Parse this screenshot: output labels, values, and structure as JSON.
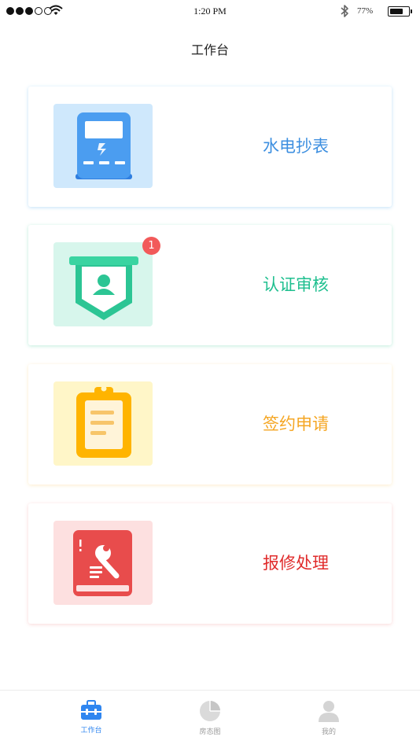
{
  "status_bar": {
    "time": "1:20 PM",
    "battery_percent": "77%",
    "signal_bars_filled": 3,
    "signal_bars_total": 5
  },
  "header": {
    "title": "工作台"
  },
  "cards": [
    {
      "label": "水电抄表",
      "icon": "meter-reading-icon",
      "color": "#3d8fe0",
      "tile_bg": "#cfe8fc"
    },
    {
      "label": "认证审核",
      "icon": "certification-review-icon",
      "color": "#1fbf8f",
      "tile_bg": "#d7f6ec",
      "badge": "1"
    },
    {
      "label": "签约申请",
      "icon": "contract-application-icon",
      "color": "#f5a623",
      "tile_bg": "#fff6c8"
    },
    {
      "label": "报修处理",
      "icon": "repair-handling-icon",
      "color": "#e02b2b",
      "tile_bg": "#fde0e0"
    }
  ],
  "tabbar": {
    "items": [
      {
        "label": "工作台",
        "icon": "workbench-icon",
        "active": true,
        "color": "#2f86f0"
      },
      {
        "label": "房态图",
        "icon": "room-status-chart-icon",
        "active": false,
        "color": "#9b9b9b"
      },
      {
        "label": "我的",
        "icon": "profile-icon",
        "active": false,
        "color": "#9b9b9b"
      }
    ]
  }
}
